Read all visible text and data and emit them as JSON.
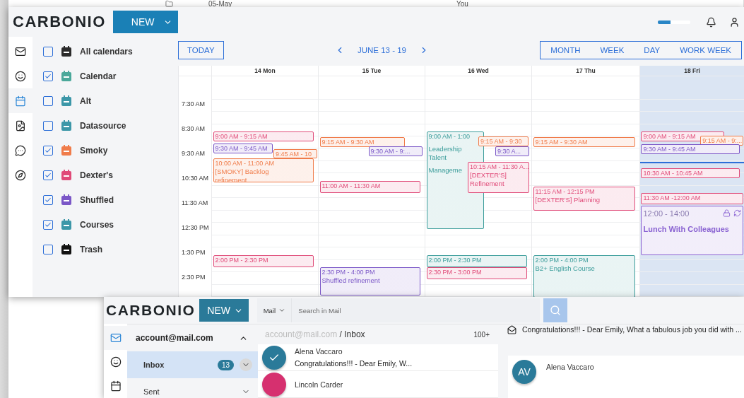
{
  "back_window": {
    "cells": [
      "05-May",
      "You"
    ]
  },
  "calendar_app": {
    "logo": "CARBONIO",
    "new_button": "NEW",
    "storage": {
      "level": 0.4
    },
    "rail": [
      {
        "kind": "mail",
        "selected": false
      },
      {
        "kind": "contacts",
        "selected": false
      },
      {
        "kind": "calendar",
        "selected": true
      },
      {
        "kind": "files",
        "selected": false
      },
      {
        "kind": "chat",
        "selected": false
      },
      {
        "kind": "search",
        "selected": false
      }
    ],
    "calendars": [
      {
        "name": "All calendars",
        "checked": false,
        "color": "#2b2b2b"
      },
      {
        "name": "Calendar",
        "checked": true,
        "color": "#4aa89a"
      },
      {
        "name": "Alt",
        "checked": false,
        "color": "#3c97a8"
      },
      {
        "name": "Datasource",
        "checked": false,
        "color": "#3c97a8"
      },
      {
        "name": "Smoky",
        "checked": true,
        "color": "#f07c4a"
      },
      {
        "name": "Dexter's",
        "checked": true,
        "color": "#e04a78"
      },
      {
        "name": "Shuffled",
        "checked": true,
        "color": "#7b57c7"
      },
      {
        "name": "Courses",
        "checked": true,
        "color": "#3c97a8"
      },
      {
        "name": "Trash",
        "checked": false,
        "color": "#111111"
      }
    ],
    "toolbar": {
      "today": "TODAY",
      "range": "JUNE 13 - 19",
      "views": [
        "MONTH",
        "WEEK",
        "DAY",
        "WORK WEEK"
      ]
    },
    "times": [
      "7:30 AM",
      "8:30 AM",
      "9:30 AM",
      "10:30 AM",
      "11:30 AM",
      "12:30 PM",
      "1:30 PM",
      "2:30 PM"
    ],
    "days": [
      {
        "label": "14 Mon",
        "selected": false,
        "events": [
          {
            "time": "9:00 AM - 9:15 AM",
            "color": "#e04a78"
          },
          {
            "time": "9:30 AM - 9:45 AM",
            "color": "#7b57c7"
          },
          {
            "time": "9:45 AM - 10",
            "color": "#f07c4a"
          },
          {
            "time": "10:00 AM - 11:00 AM",
            "lines": [
              "[SMOKY] Backlog",
              "refinement"
            ],
            "color": "#f07c4a"
          },
          {
            "time": "2:00 PM - 2:30 PM",
            "color": "#e04a78"
          }
        ]
      },
      {
        "label": "15 Tue",
        "selected": false,
        "events": [
          {
            "time": "9:15 AM - 9:30 AM",
            "color": "#f07c4a"
          },
          {
            "time": "9:30 AM - 9:...",
            "color": "#7b57c7"
          },
          {
            "time": "11:00 AM - 11:30 AM",
            "color": "#e04a78"
          },
          {
            "time": "2:30 PM - 4:00 PM",
            "lines": [
              "Shuffled refinement"
            ],
            "color": "#7b57c7"
          }
        ]
      },
      {
        "label": "16 Wed",
        "selected": false,
        "events": [
          {
            "time": "9:00 AM - 1:00",
            "lines": [
              "Leadership",
              "Talent",
              "Manageme"
            ],
            "color": "#3a9c9a"
          },
          {
            "time": "9:15 AM - 9:30",
            "color": "#f07c4a"
          },
          {
            "time": "9:30 A...",
            "color": "#7b57c7"
          },
          {
            "time": "10:15 AM - 11:30 A...",
            "lines": [
              "[DEXTER'S]",
              "Refinement"
            ],
            "color": "#e04a78"
          },
          {
            "time": "2:00 PM - 2:30 PM",
            "color": "#3a9c9a"
          },
          {
            "time": "2:30 PM - 3:00 PM",
            "color": "#e04a78"
          }
        ]
      },
      {
        "label": "17 Thu",
        "selected": false,
        "events": [
          {
            "time": "9:15 AM - 9:30 AM",
            "color": "#f07c4a"
          },
          {
            "time": "11:15 AM - 12:15 PM",
            "lines": [
              "[DEXTER'S] Planning"
            ],
            "color": "#e04a78"
          },
          {
            "time": "2:00 PM - 4:00 PM",
            "lines": [
              "B2+ English Course"
            ],
            "color": "#3a9c9a"
          }
        ]
      },
      {
        "label": "18 Fri",
        "selected": true,
        "events": [
          {
            "time": "9:00 AM - 9:15 AM",
            "color": "#e04a78"
          },
          {
            "time": "9:15 AM - 9:...",
            "color": "#f07c4a"
          },
          {
            "time": "9:30 AM - 9:45 AM",
            "color": "#7b57c7"
          },
          {
            "time": "10:30 AM - 10:45 AM",
            "color": "#e04a78"
          },
          {
            "time": "11:30 AM -12:00 AM",
            "color": "#e04a78"
          },
          {
            "kind": "card",
            "time": "12:00 - 14:00",
            "lines": [
              "Lunch With Colleagues"
            ],
            "color": "#8a63d2"
          }
        ]
      }
    ]
  },
  "mail_app": {
    "logo": "CARBONIO",
    "new_button": "NEW",
    "search": {
      "module": "Mail",
      "placeholder": "Search in Mail"
    },
    "rail": [
      {
        "kind": "mail",
        "selected": true
      },
      {
        "kind": "contacts",
        "selected": false
      },
      {
        "kind": "calendar",
        "selected": false
      }
    ],
    "account": {
      "name": "account@mail.com",
      "expanded": true
    },
    "folders": [
      {
        "name": "Inbox",
        "count": "13",
        "selected": true
      },
      {
        "name": "Sent",
        "selected": false
      }
    ],
    "breadcrumb": {
      "account": "account@mail.com",
      "folder": "/ Inbox"
    },
    "total": "100+",
    "messages": [
      {
        "sender": "Alena Vaccaro",
        "preview": "Congratulations!!! -  Dear Emily, W...",
        "selected": true,
        "color": "#2a7a99"
      },
      {
        "sender": "Lincoln Carder",
        "selected": false,
        "color": "#d6306f"
      }
    ],
    "reading": {
      "subject": "Congratulations!!! - Dear Emily, What a fabulous job you did with ...",
      "initials": "AV",
      "sender": "Alena Vaccaro"
    }
  }
}
